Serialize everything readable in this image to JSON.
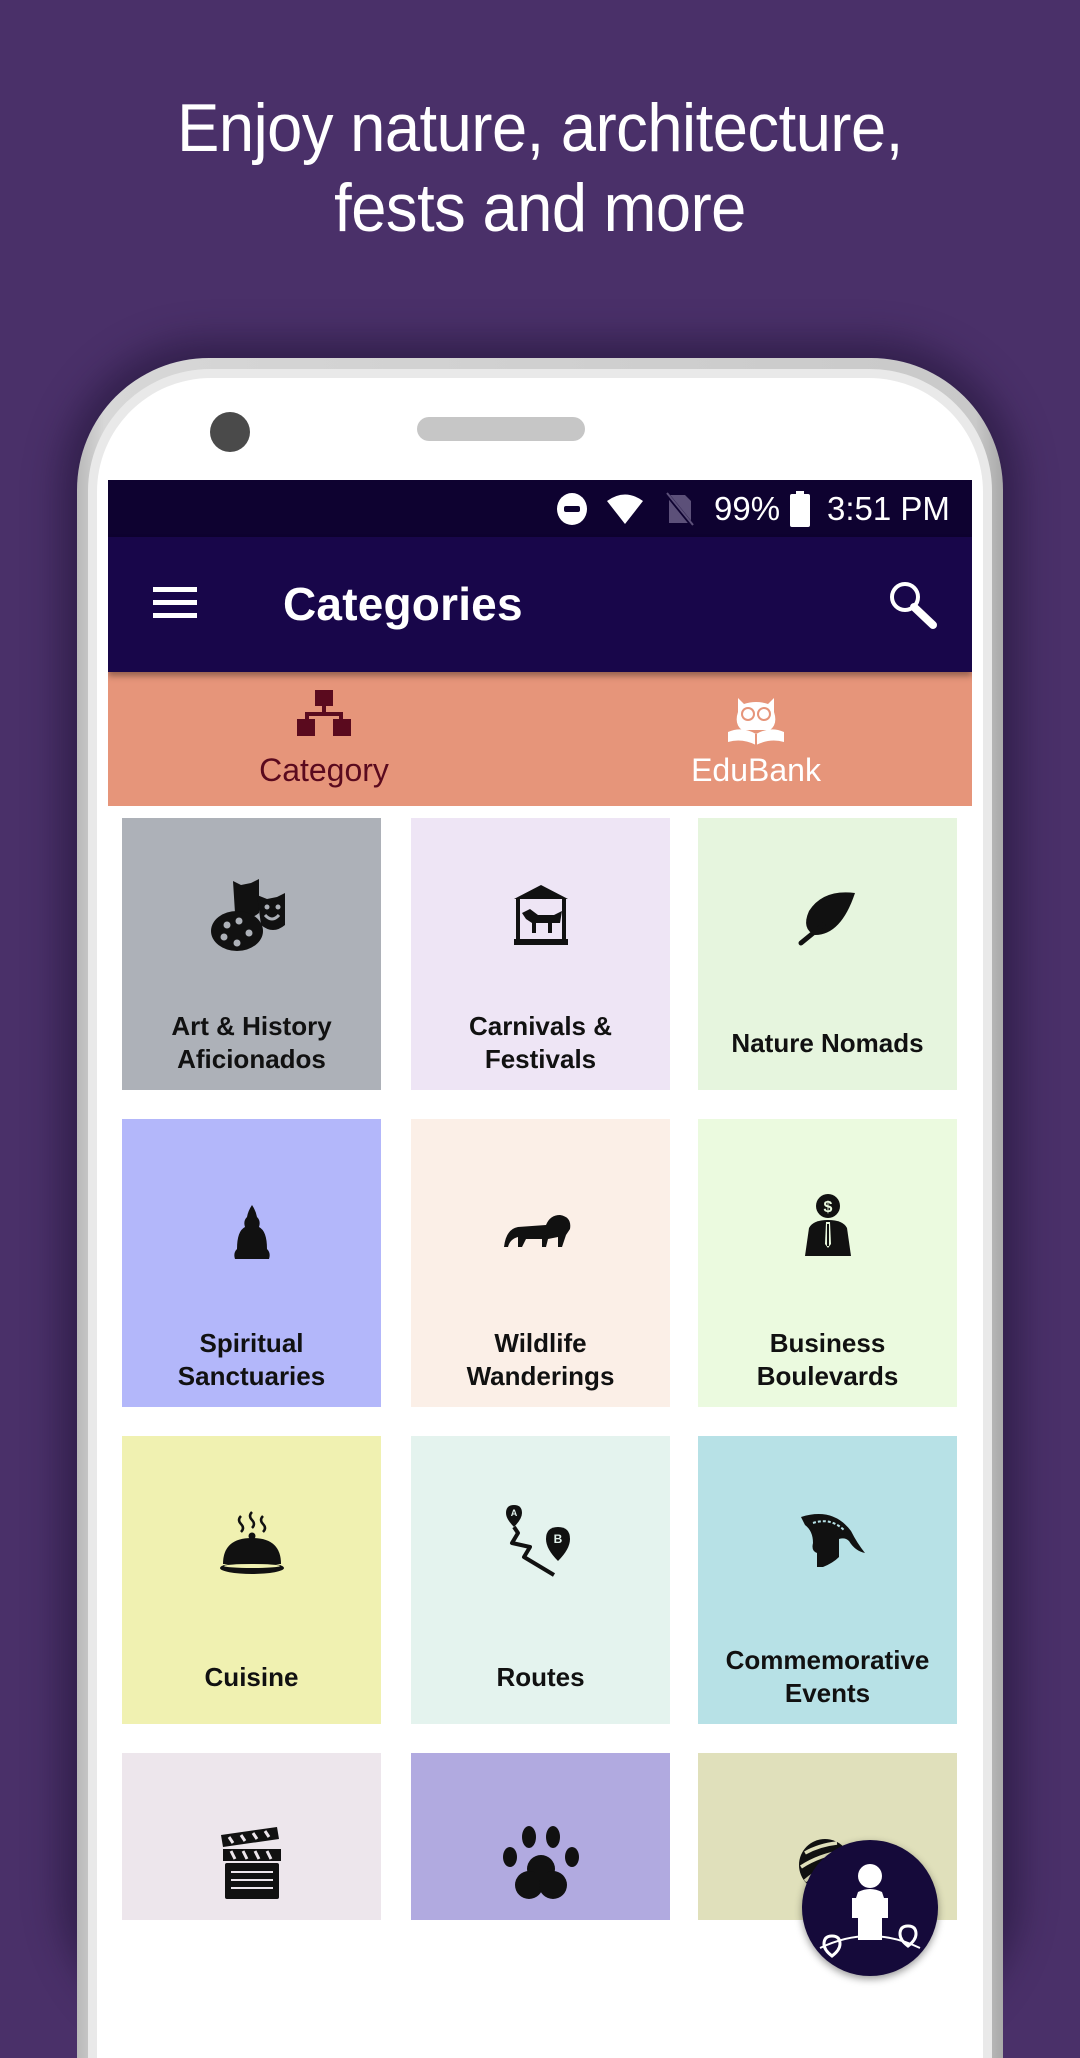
{
  "promo": {
    "headline_line1": "Enjoy nature, architecture,",
    "headline_line2": "fests and more"
  },
  "status_bar": {
    "battery_percent": "99%",
    "time": "3:51 PM",
    "icons": [
      "do-not-disturb-icon",
      "wifi-icon",
      "no-sim-icon",
      "battery-icon"
    ]
  },
  "app_bar": {
    "title": "Categories",
    "menu_icon": "hamburger-menu-icon",
    "search_icon": "search-icon"
  },
  "tabs": [
    {
      "label": "Category",
      "icon": "hierarchy-icon",
      "active": true
    },
    {
      "label": "EduBank",
      "icon": "owl-book-icon",
      "active": false
    }
  ],
  "categories": [
    {
      "label": "Art & History Aficionados",
      "icon": "theater-masks-palette-icon",
      "color": "#adb1b8"
    },
    {
      "label": "Carnivals & Festivals",
      "icon": "carousel-icon",
      "color": "#eee5f5"
    },
    {
      "label": "Nature Nomads",
      "icon": "leaf-icon",
      "color": "#e6f5de"
    },
    {
      "label": "Spiritual Sanctuaries",
      "icon": "buddha-icon",
      "color": "#b3b7fa"
    },
    {
      "label": "Wildlife Wanderings",
      "icon": "lion-icon",
      "color": "#fbefe7"
    },
    {
      "label": "Business Boulevards",
      "icon": "businessman-icon",
      "color": "#ebfadf"
    },
    {
      "label": "Cuisine",
      "icon": "cloche-icon",
      "color": "#f0f1b1"
    },
    {
      "label": "Routes",
      "icon": "route-icon",
      "color": "#e4f3ee"
    },
    {
      "label": "Commemorative Events",
      "icon": "spartan-helmet-icon",
      "color": "#b7e1e6"
    },
    {
      "label": "",
      "icon": "clapperboard-icon",
      "color": "#ede6ec"
    },
    {
      "label": "",
      "icon": "paw-icon",
      "color": "#b1aae0"
    },
    {
      "label": "",
      "icon": "yarn-ball-icon",
      "color": "#e0e0bb"
    }
  ],
  "fab": {
    "icon": "person-locations-icon"
  },
  "colors": {
    "background": "#4a3069",
    "status_bar": "#0e0230",
    "app_bar": "#18064a",
    "tab_bar": "#e6957a",
    "tab_active_text": "#5a0a1e",
    "fab": "#150a3a"
  }
}
